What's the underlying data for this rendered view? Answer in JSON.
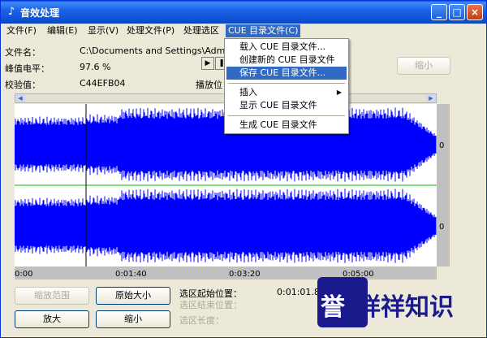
{
  "window": {
    "title": "音效处理",
    "buttons": {
      "minimize": "_",
      "maximize": "□",
      "close": "×"
    }
  },
  "menu": {
    "items": [
      {
        "label": "文件(F)"
      },
      {
        "label": "编辑(E)"
      },
      {
        "label": "显示(V)"
      },
      {
        "label": "处理文件(P)"
      },
      {
        "label": "处理选区"
      },
      {
        "label": "CUE 目录文件(C)"
      }
    ]
  },
  "info": {
    "file_label": "文件名：",
    "file_value": "C:\\Documents and Settings\\Administrator",
    "peak_label": "峰值电平：",
    "peak_value": "97.6 %",
    "checksum_label": "校验值：",
    "checksum_value": "C44EFB04",
    "play_pos_label": "播放位"
  },
  "transport": {
    "play": "▶",
    "pause": "❚"
  },
  "buttons": {
    "shrink_top": "缩小",
    "zoom_range": "缩放范围",
    "original_size": "原始大小",
    "zoom_in": "放大",
    "zoom_out": "缩小"
  },
  "dropdown": {
    "items": [
      {
        "label": "载入 CUE 目录文件...",
        "highlighted": false
      },
      {
        "label": "创建新的 CUE 目录文件",
        "highlighted": false
      },
      {
        "label": "保存 CUE 目录文件...",
        "highlighted": true
      },
      {
        "label": "插入",
        "submenu": true
      },
      {
        "label": "显示 CUE 目录文件",
        "highlighted": false
      },
      {
        "label": "生成 CUE 目录文件",
        "highlighted": false
      }
    ]
  },
  "waveform": {
    "channel_zero_label": "0",
    "timeline": [
      "0:00",
      "0:01:40",
      "0:03:20",
      "0:05:00"
    ],
    "colors": {
      "wave": "#0000ff",
      "center_line": "#00c000",
      "gray": "#c0c0c0"
    }
  },
  "selection": {
    "start_label": "选区起始位置：",
    "start_value": "0:01:01.859",
    "end_label": "选区结束位置：",
    "length_label": "选区长度："
  },
  "watermark": {
    "text1": "誉",
    "text2": "祥祥知识"
  }
}
